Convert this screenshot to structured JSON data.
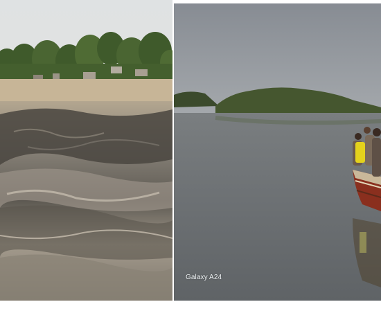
{
  "photos": {
    "left": {
      "scene": "dry-mudflat"
    },
    "right": {
      "scene": "river-boat",
      "watermark": "Galaxy A24"
    }
  },
  "palette": {
    "sky_left": "#d9dde0",
    "trees": "#3f5a2b",
    "sand": "#b9a98c",
    "mud_dark": "#4a4640",
    "mud_light": "#9c9489",
    "sky_right": "#8c9197",
    "water": "#6f7478",
    "mangrove": "#3b4a2c",
    "boat_red": "#8a2f1e",
    "shirt_yellow": "#e4d21c"
  }
}
